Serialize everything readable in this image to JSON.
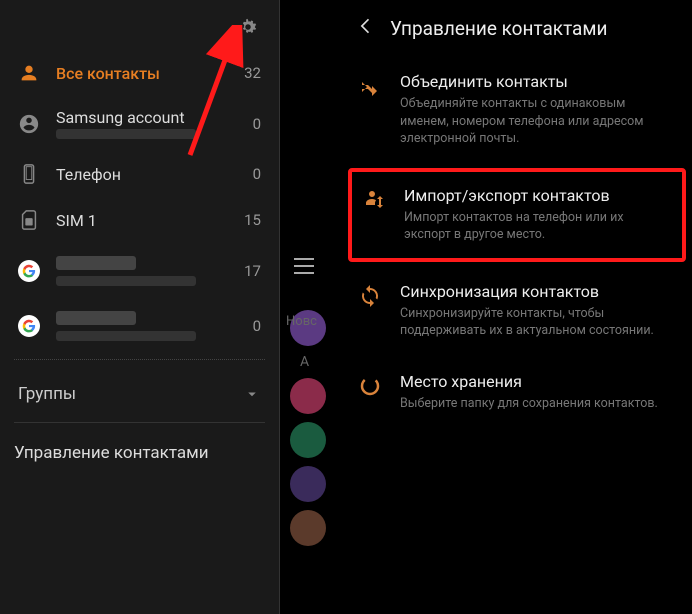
{
  "left": {
    "accounts": [
      {
        "label": "Все контакты",
        "count": 32,
        "icon": "person",
        "active": true
      },
      {
        "label": "Samsung account",
        "count": 0,
        "icon": "account-circle",
        "sub_blurred": true
      },
      {
        "label": "Телефон",
        "count": 0,
        "icon": "phone"
      },
      {
        "label": "SIM 1",
        "count": 15,
        "icon": "sim"
      },
      {
        "label_blurred": true,
        "count": 17,
        "icon": "google",
        "sub_blurred": true
      },
      {
        "label_blurred": true,
        "count": 0,
        "icon": "google",
        "sub_blurred": true
      }
    ],
    "groups_label": "Группы",
    "manage_label": "Управление контактами"
  },
  "middle": {
    "text": "Новс",
    "letter": "А"
  },
  "right": {
    "title": "Управление контактами",
    "options": [
      {
        "icon": "merge",
        "title": "Объединить контакты",
        "desc": "Объединяйте контакты с одинаковым именем, номером телефона или адресом электронной почты."
      },
      {
        "icon": "import-export",
        "title": "Импорт/экспорт контактов",
        "desc": "Импорт контактов на телефон или их экспорт в другое место.",
        "highlighted": true
      },
      {
        "icon": "sync",
        "title": "Синхронизация контактов",
        "desc": "Синхронизируйте контакты, чтобы поддерживать их в актуальном состоянии."
      },
      {
        "icon": "storage",
        "title": "Место хранения",
        "desc": "Выберите папку для сохранения контактов."
      }
    ]
  }
}
